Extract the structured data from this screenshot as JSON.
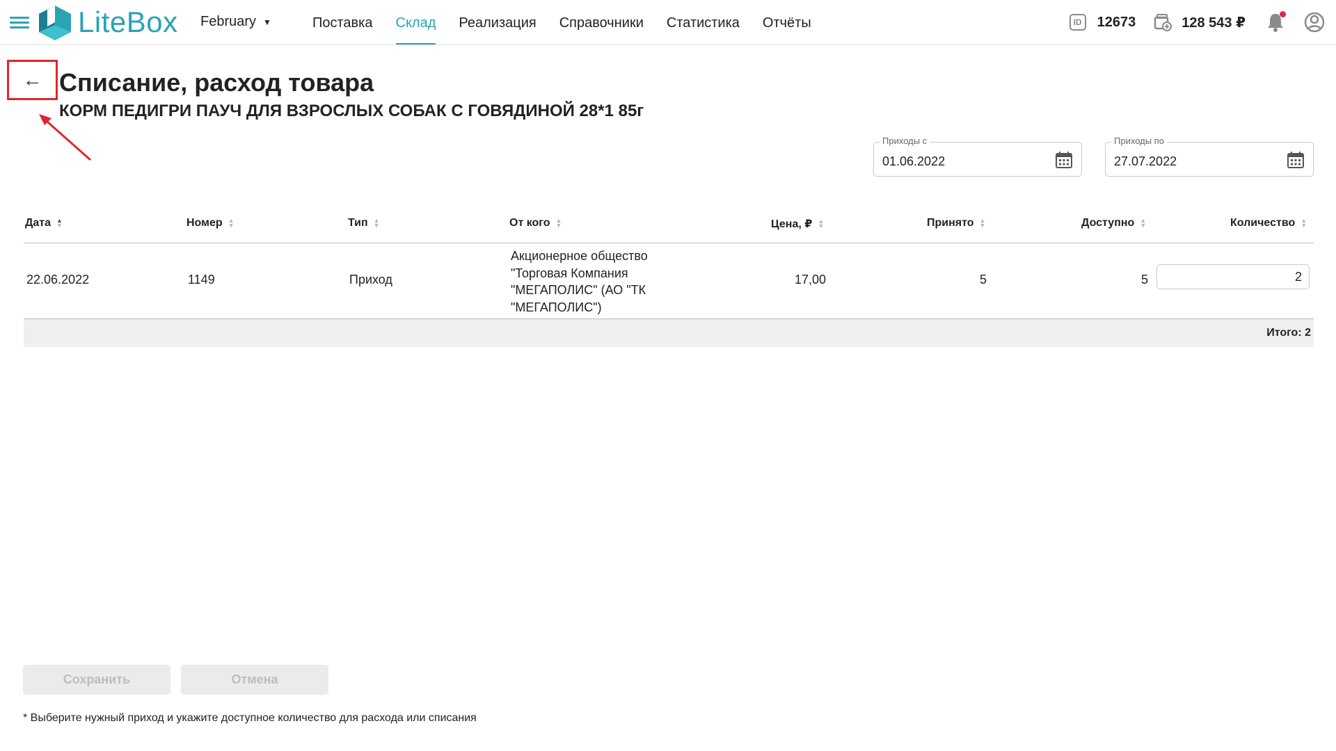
{
  "app": {
    "logo_text": "LiteBox",
    "month": "February",
    "brand_color": "#2aa3b4"
  },
  "nav": {
    "items": [
      {
        "label": "Поставка"
      },
      {
        "label": "Склад",
        "active": true
      },
      {
        "label": "Реализация"
      },
      {
        "label": "Справочники"
      },
      {
        "label": "Статистика"
      },
      {
        "label": "Отчёты"
      }
    ]
  },
  "header_right": {
    "id_badge": "ID",
    "id_value": "12673",
    "balance": "128 543 ₽"
  },
  "page": {
    "back_icon": "←",
    "title": "Списание, расход товара",
    "subtitle": "КОРМ ПЕДИГРИ ПАУЧ ДЛЯ ВЗРОСЛЫХ СОБАК С ГОВЯДИНОЙ 28*1 85г"
  },
  "filters": {
    "from_label": "Приходы с",
    "from_value": "01.06.2022",
    "to_label": "Приходы по",
    "to_value": "27.07.2022"
  },
  "table": {
    "columns": [
      "Дата",
      "Номер",
      "Тип",
      "От кого",
      "Цена, ₽",
      "Принято",
      "Доступно",
      "Количество"
    ],
    "rows": [
      {
        "date": "22.06.2022",
        "number": "1149",
        "type": "Приход",
        "from_lines": [
          "Акционерное общество",
          "\"Торговая Компания",
          "\"МЕГАПОЛИС\" (АО \"ТК",
          "\"МЕГАПОЛИС\")"
        ],
        "price": "17,00",
        "received": "5",
        "available": "5",
        "quantity": "2"
      }
    ],
    "total": "Итого: 2"
  },
  "actions": {
    "save": "Сохранить",
    "cancel": "Отмена"
  },
  "footnote": "* Выберите нужный приход и укажите доступное количество для расхода или списания"
}
